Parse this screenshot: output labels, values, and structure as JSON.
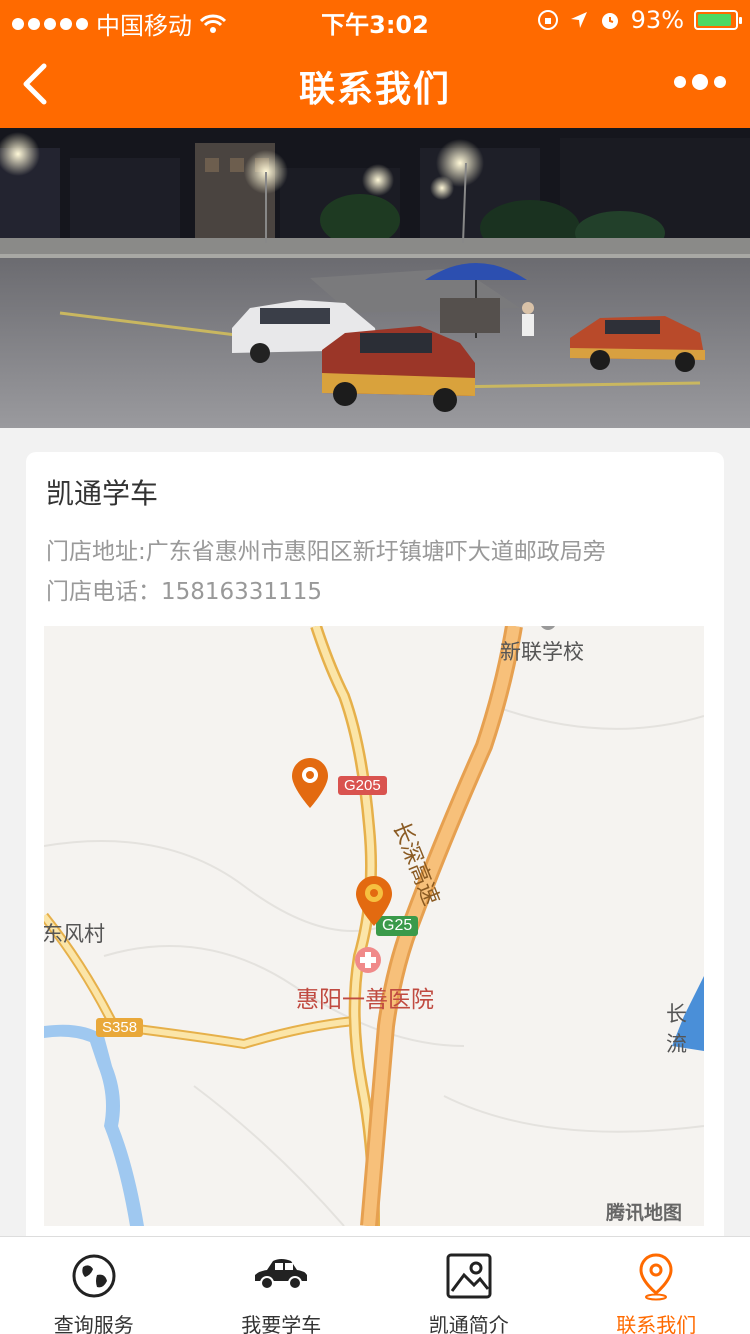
{
  "status_bar": {
    "carrier": "中国移动",
    "time": "下午3:02",
    "battery": "93%"
  },
  "nav": {
    "title": "联系我们"
  },
  "store": {
    "name": "凯通学车",
    "address": "门店地址:广东省惠州市惠阳区新圩镇塘吓大道邮政局旁",
    "phone": "门店电话：15816331115"
  },
  "map": {
    "labels": {
      "school": "新联学校",
      "village": "东风村",
      "hospital": "惠阳一善医院",
      "expressway": "长深高速",
      "right_edge": "长流",
      "provider": "腾讯地图"
    },
    "shields": {
      "g205": "G205",
      "g25": "G25",
      "s358": "S358"
    },
    "colors": {
      "road_major": "#f6c566",
      "road_minor": "#fbe5a8",
      "water": "#9fc8f0",
      "marker": "#e36a10"
    }
  },
  "tabs": [
    {
      "label": "查询服务",
      "icon": "globe-icon",
      "active": false
    },
    {
      "label": "我要学车",
      "icon": "car-icon",
      "active": false
    },
    {
      "label": "凯通简介",
      "icon": "image-icon",
      "active": false
    },
    {
      "label": "联系我们",
      "icon": "location-pin-icon",
      "active": true
    }
  ],
  "colors": {
    "accent": "#ff6a00"
  }
}
